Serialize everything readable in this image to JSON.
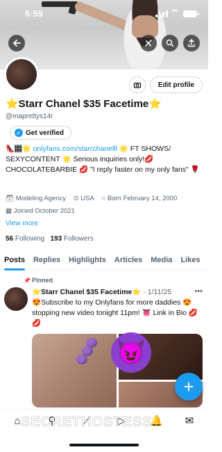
{
  "status_bar": {
    "time": "6:59"
  },
  "profile": {
    "display_name": "⭐Starr Chanel $35 Facetime⭐",
    "handle": "@maprettys14r",
    "verify_label": "Get verified",
    "edit_label": "Edit profile",
    "bio_prefix": "👠🏾🌟 ",
    "bio_link": "onlyfans.com/starrchanelll",
    "bio_rest": " 🌟 FT SHOWS/ SEXYCONTENT 🌟 Serious inquiries only!💋 CHOCOLATEBARBIE 💋 \"I reply faster on my only fans\" 🌹",
    "category": "Modeling Agency",
    "location": "USA",
    "born": "Born February 14, 2000",
    "joined": "Joined October 2021",
    "view_more": "View more",
    "following_count": "56",
    "following_label": "Following",
    "followers_count": "193",
    "followers_label": "Followers"
  },
  "tabs": [
    {
      "label": "Posts",
      "active": true
    },
    {
      "label": "Replies",
      "active": false
    },
    {
      "label": "Highlights",
      "active": false
    },
    {
      "label": "Articles",
      "active": false
    },
    {
      "label": "Media",
      "active": false
    },
    {
      "label": "Likes",
      "active": false
    }
  ],
  "post": {
    "pinned_label": "Pinned",
    "author": "⭐Starr Chanel $35 Facetime⭐",
    "date": "· 1/11/25",
    "text": "😍Subscribe to my Onlyfans for more daddies 😍 stopping new video tonight 11pm! 👅 Link in Bio 💋💋"
  },
  "watermark": "SECRETHOSTESS",
  "icons": {
    "back": "arrow-left-icon",
    "grok": "grok-icon",
    "search": "search-icon",
    "share": "share-icon",
    "camera": "camera-icon",
    "fab": "plus-icon"
  },
  "colors": {
    "accent": "#1d9bf0",
    "text": "#0f1419",
    "muted": "#536471"
  }
}
